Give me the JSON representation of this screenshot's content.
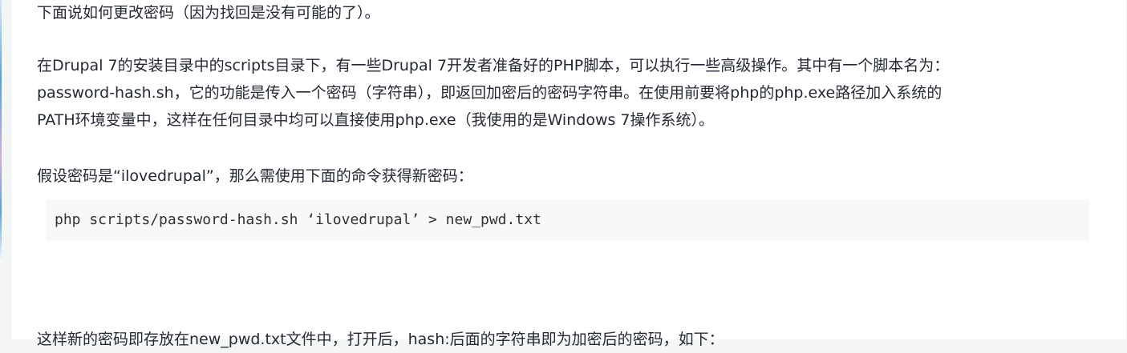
{
  "article": {
    "para1": "下面说如何更改密码（因为找回是没有可能的了）。",
    "para2_line1": "在Drupal 7的安装目录中的scripts目录下，有一些Drupal 7开发者准备好的PHP脚本，可以执行一些高级操作。其中有一个脚本名为：",
    "para2_line2": "password-hash.sh，它的功能是传入一个密码（字符串），即返回加密后的密码字符串。在使用前要将php的php.exe路径加入系统的",
    "para2_line3": "PATH环境变量中，这样在任何目录中均可以直接使用php.exe（我使用的是Windows 7操作系统）。",
    "para3": "假设密码是“ilovedrupal”，那么需使用下面的命令获得新密码：",
    "code": "php scripts/password-hash.sh ‘ilovedrupal’ > new_pwd.txt",
    "para4_partial": "这样新的密码即存放在new_pwd.txt文件中，打开后，hash:后面的字符串即为加密后的密码，如下："
  }
}
